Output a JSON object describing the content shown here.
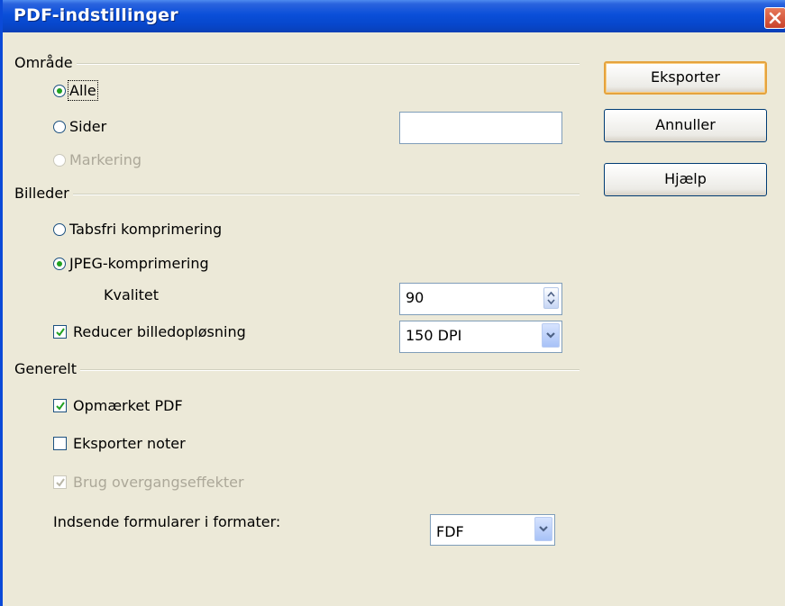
{
  "window": {
    "title": "PDF-indstillinger"
  },
  "groups": {
    "range": {
      "label": "Område",
      "all": "Alle",
      "pages": "Sider",
      "pages_value": "",
      "selection": "Markering"
    },
    "images": {
      "label": "Billeder",
      "lossless": "Tabsfri komprimering",
      "jpeg": "JPEG-komprimering",
      "quality_label": "Kvalitet",
      "quality_value": "90",
      "reduce_label": "Reducer billedopløsning",
      "reduce_value": "150 DPI"
    },
    "general": {
      "label": "Generelt",
      "tagged": "Opmærket PDF",
      "notes": "Eksporter noter",
      "transitions": "Brug overgangseffekter",
      "submit_label": "Indsende formularer i formater:",
      "submit_value": "FDF"
    }
  },
  "buttons": {
    "export": "Eksporter",
    "cancel": "Annuller",
    "help": "Hjælp"
  },
  "state": {
    "range_selected": "all",
    "compression_selected": "jpeg",
    "reduce_checked": true,
    "tagged_checked": true,
    "notes_checked": false,
    "transitions_checked": true,
    "selection_disabled": true,
    "transitions_disabled": true
  },
  "colors": {
    "titlebar": "#0A4FD9",
    "dialog_bg": "#ECE9D8",
    "radio_dot": "#21A121",
    "default_button_border": "#E5A33D"
  }
}
